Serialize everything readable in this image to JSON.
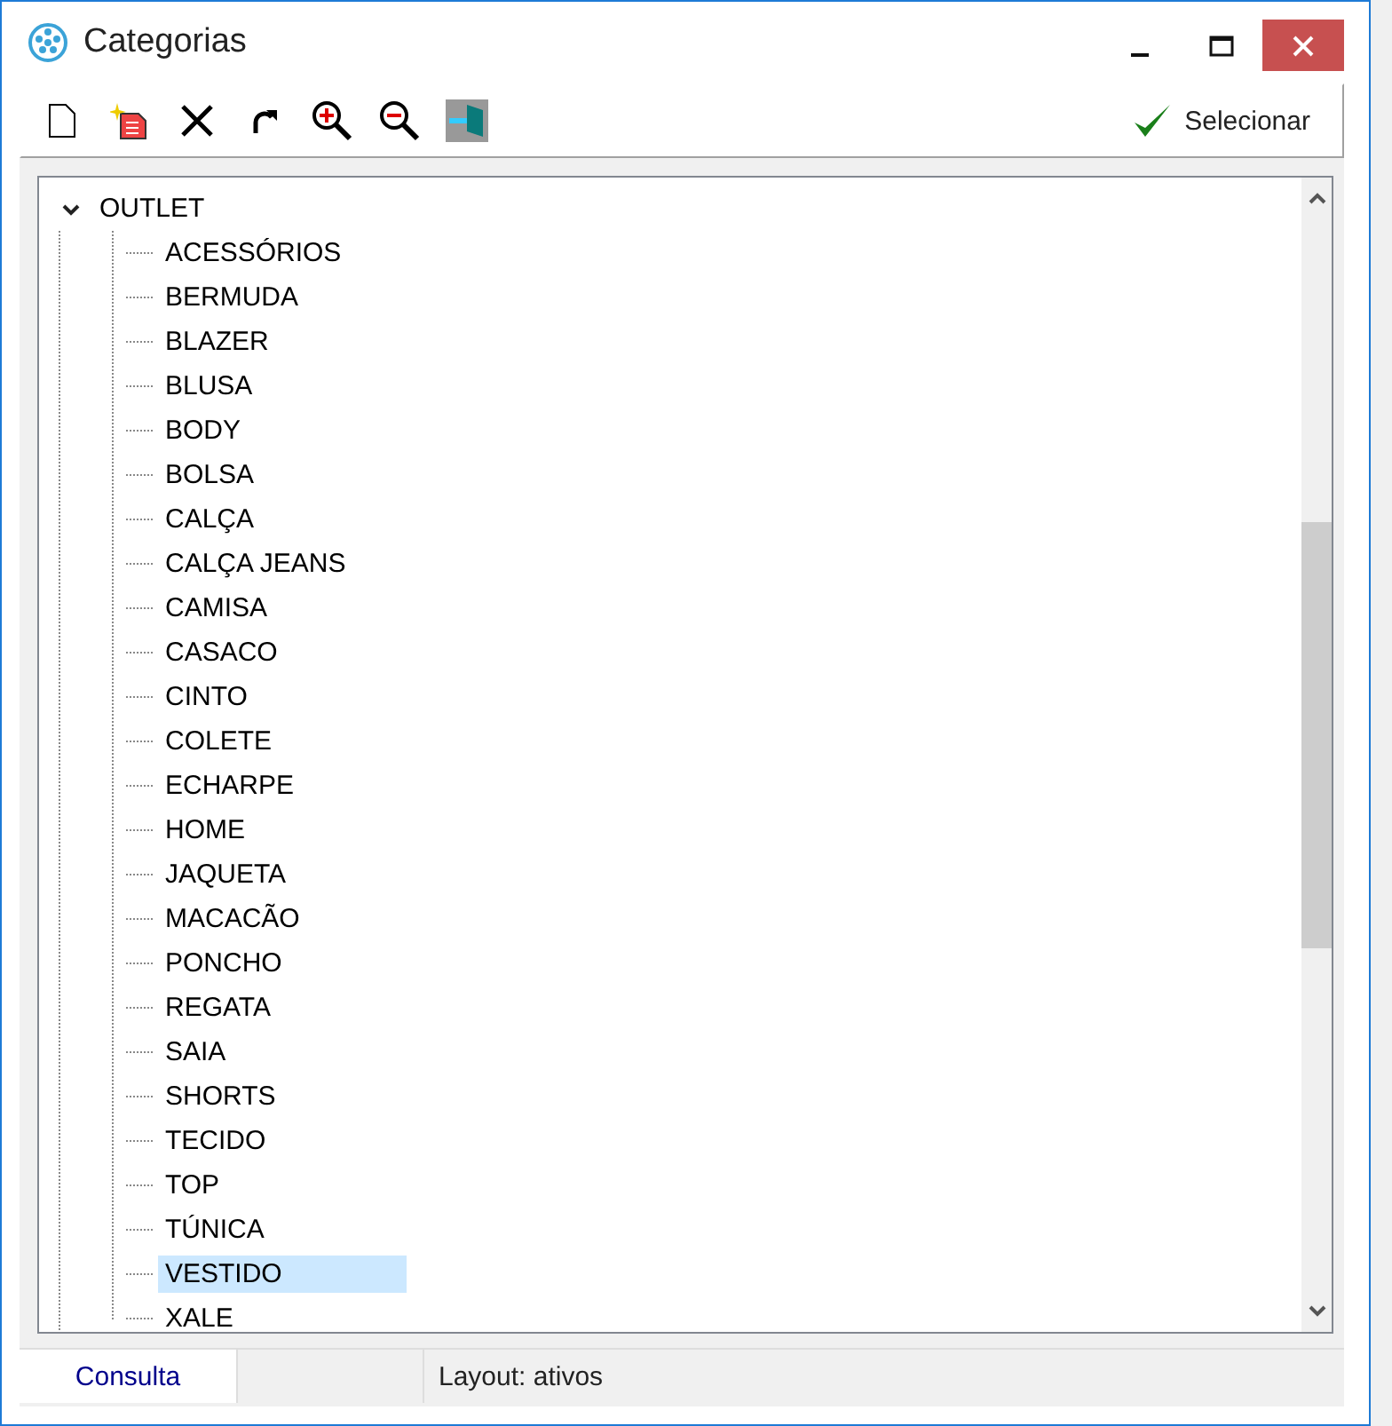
{
  "window": {
    "title": "Categorias"
  },
  "toolbar": {
    "select_button": "Selecionar"
  },
  "tree": {
    "label": "OUTLET",
    "expanded": true,
    "children": [
      {
        "label": "ACESSÓRIOS",
        "selected": false
      },
      {
        "label": "BERMUDA",
        "selected": false
      },
      {
        "label": "BLAZER",
        "selected": false
      },
      {
        "label": "BLUSA",
        "selected": false
      },
      {
        "label": "BODY",
        "selected": false
      },
      {
        "label": "BOLSA",
        "selected": false
      },
      {
        "label": "CALÇA",
        "selected": false
      },
      {
        "label": "CALÇA JEANS",
        "selected": false
      },
      {
        "label": "CAMISA",
        "selected": false
      },
      {
        "label": "CASACO",
        "selected": false
      },
      {
        "label": "CINTO",
        "selected": false
      },
      {
        "label": "COLETE",
        "selected": false
      },
      {
        "label": "ECHARPE",
        "selected": false
      },
      {
        "label": "HOME",
        "selected": false
      },
      {
        "label": "JAQUETA",
        "selected": false
      },
      {
        "label": "MACACÃO",
        "selected": false
      },
      {
        "label": "PONCHO",
        "selected": false
      },
      {
        "label": "REGATA",
        "selected": false
      },
      {
        "label": "SAIA",
        "selected": false
      },
      {
        "label": "SHORTS",
        "selected": false
      },
      {
        "label": "TECIDO",
        "selected": false
      },
      {
        "label": "TOP",
        "selected": false
      },
      {
        "label": "TÚNICA",
        "selected": false
      },
      {
        "label": "VESTIDO",
        "selected": true
      },
      {
        "label": "XALE",
        "selected": false
      }
    ]
  },
  "status_bar": {
    "tab": "Consulta",
    "layout": "Layout: ativos"
  }
}
